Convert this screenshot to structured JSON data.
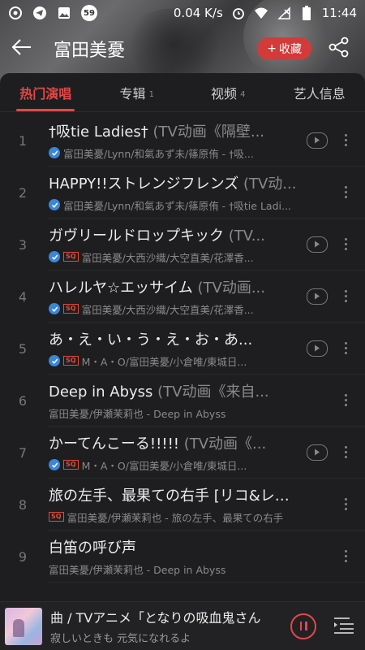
{
  "statusbar": {
    "speed": "0.04 K/s",
    "time": "11:44",
    "badge": "59"
  },
  "header": {
    "artist": "富田美憂",
    "fav_label": "收藏"
  },
  "tabs": [
    {
      "label": "热门演唱",
      "count": "",
      "active": true
    },
    {
      "label": "专辑",
      "count": "1",
      "active": false
    },
    {
      "label": "视频",
      "count": "4",
      "active": false
    },
    {
      "label": "艺人信息",
      "count": "",
      "active": false
    }
  ],
  "songs": [
    {
      "num": "1",
      "title": "†吸tie Ladies†",
      "sub": " (TV动画《隔壁...",
      "artists": "富田美憂/Lynn/和氣あず未/篠原侑 - †吸...",
      "verified": true,
      "sq": false,
      "mv": true
    },
    {
      "num": "2",
      "title": "HAPPY!!ストレンジフレンズ",
      "sub": " (TV动...",
      "artists": "富田美憂/Lynn/和氣あず未/篠原侑 - †吸tie Ladi...",
      "verified": true,
      "sq": false,
      "mv": false
    },
    {
      "num": "3",
      "title": "ガヴリールドロップキック",
      "sub": " (TV...",
      "artists": "富田美憂/大西沙織/大空直美/花澤香...",
      "verified": true,
      "sq": true,
      "mv": true
    },
    {
      "num": "4",
      "title": "ハレルヤ☆エッサイム",
      "sub": " (TV动画...",
      "artists": "富田美憂/大西沙織/大空直美/花澤香...",
      "verified": true,
      "sq": true,
      "mv": true
    },
    {
      "num": "5",
      "title": "あ・え・い・う・え・お・あ...",
      "sub": "",
      "artists": "M・A・O/富田美憂/小倉唯/東城日...",
      "verified": true,
      "sq": true,
      "mv": true
    },
    {
      "num": "6",
      "title": "Deep in Abyss",
      "sub": " (TV动画《来自...",
      "artists": "富田美憂/伊瀬茉莉也 - Deep in Abyss",
      "verified": false,
      "sq": false,
      "mv": false
    },
    {
      "num": "7",
      "title": "かーてんこーる!!!!!",
      "sub": " (TV动画《...",
      "artists": "M・A・O/富田美憂/小倉唯/東城日...",
      "verified": true,
      "sq": true,
      "mv": true
    },
    {
      "num": "8",
      "title": "旅の左手、最果ての右手 [リコ&レグ...",
      "sub": "",
      "artists": "富田美憂/伊瀬茉莉也 - 旅の左手、最果ての右手",
      "verified": false,
      "sq": true,
      "mv": false
    },
    {
      "num": "9",
      "title": "白笛の呼び声",
      "sub": "",
      "artists": "富田美憂/伊瀬茉莉也 - Deep in Abyss",
      "verified": false,
      "sq": false,
      "mv": false
    }
  ],
  "player": {
    "title": "曲 / TVアニメ「となりの吸血鬼さん",
    "lyric": "寂しいときも 元気になれるよ"
  },
  "colors": {
    "accent": "#e34848",
    "verified": "#3a86d8",
    "sq": "#e04a3a"
  }
}
